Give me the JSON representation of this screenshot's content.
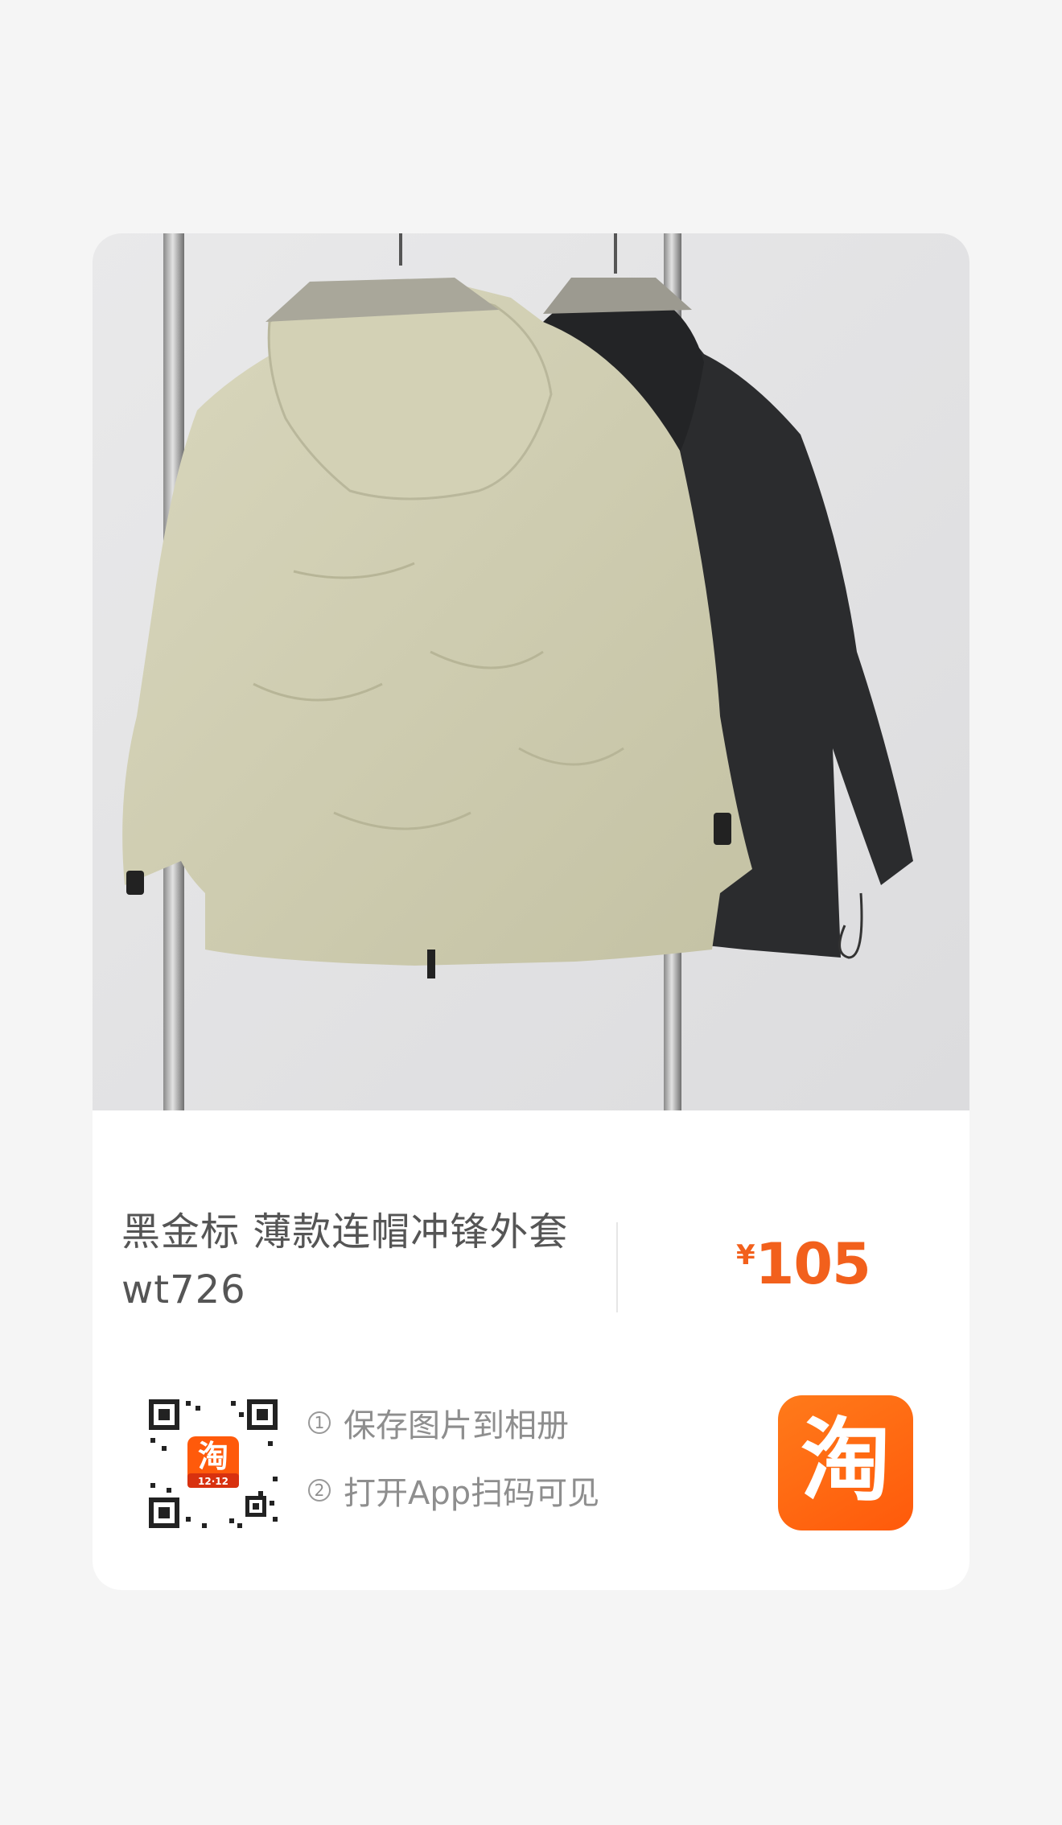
{
  "product": {
    "title_line1": "黑金标 薄款连帽冲锋外套",
    "title_line2": "wt726",
    "currency": "¥",
    "price": "105"
  },
  "share": {
    "step1_num": "1",
    "step1": "保存图片到相册",
    "step2_num": "2",
    "step2": "打开App扫码可见"
  },
  "app": {
    "icon_glyph": "淘",
    "qr_badge_glyph": "淘",
    "qr_badge_text": "12·12"
  },
  "colors": {
    "accent": "#f2601c",
    "brand": "#ff5a0b",
    "jacket_khaki": "#cfcdb0",
    "jacket_black": "#2b2c2e"
  },
  "icons": [
    "qr-code-icon",
    "taobao-app-icon",
    "circled-number-icon"
  ]
}
